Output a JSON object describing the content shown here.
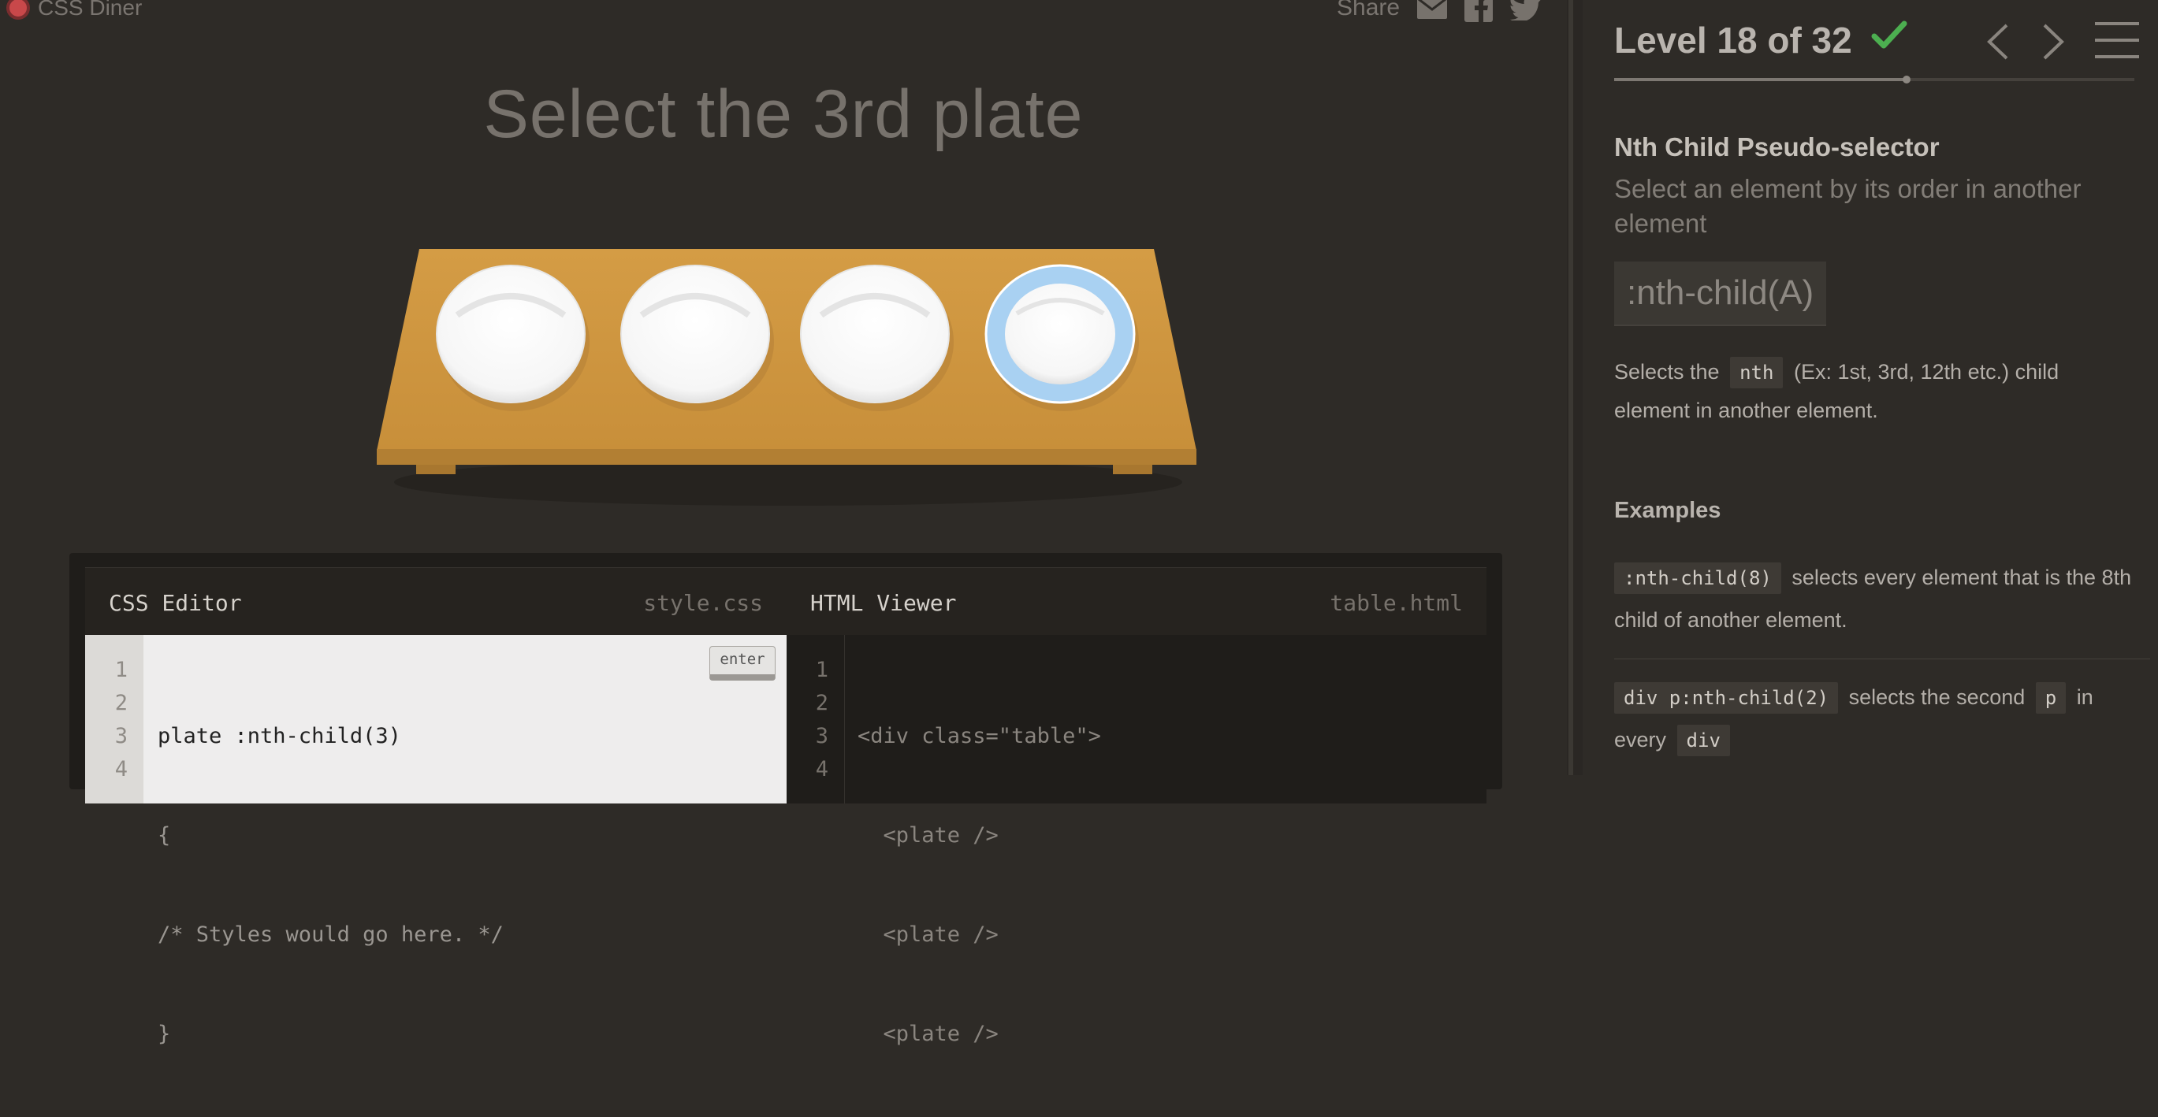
{
  "app": {
    "name": "CSS Diner"
  },
  "share": {
    "label": "Share",
    "icons": [
      "mail-icon",
      "facebook-icon",
      "twitter-icon"
    ]
  },
  "game": {
    "instruction": "Select the 3rd plate",
    "plates": [
      {
        "name": "plate",
        "selected": false
      },
      {
        "name": "plate",
        "selected": false
      },
      {
        "name": "plate",
        "selected": false
      },
      {
        "name": "plate",
        "selected": true
      }
    ]
  },
  "css_editor": {
    "title": "CSS Editor",
    "file": "style.css",
    "enter_label": "enter",
    "line_numbers": [
      "1",
      "2",
      "3",
      "4"
    ],
    "lines": [
      "plate :nth-child(3)",
      "{",
      "/* Styles would go here. */",
      "}"
    ]
  },
  "html_viewer": {
    "title": "HTML Viewer",
    "file": "table.html",
    "line_numbers": [
      "1",
      "2",
      "3",
      "4"
    ],
    "lines": [
      "<div class=\"table\">",
      "  <plate />",
      "  <plate />",
      "  <plate />"
    ]
  },
  "sidebar": {
    "level_text": "Level 18 of 32",
    "level_current": 18,
    "level_total": 32,
    "completed": true,
    "selector_name": "Nth Child Pseudo-selector",
    "selector_title": "Select an element by its order in another element",
    "syntax": ":nth-child(A)",
    "description": {
      "before": "Selects the",
      "code": "nth",
      "after": "(Ex: 1st, 3rd, 12th etc.) child element in another element."
    },
    "examples_heading": "Examples",
    "examples": [
      {
        "code": ":nth-child(8)",
        "text": "selects every element that is the 8th child of another element."
      },
      {
        "code": "div p:nth-child(2)",
        "text_a": "selects the second",
        "code_b": "p",
        "text_b": "in every",
        "code_c": "div"
      }
    ]
  },
  "colors": {
    "background": "#2e2b27",
    "table": "#d09a45",
    "plate_highlight": "#a9d1f2",
    "check": "#4caf50"
  }
}
